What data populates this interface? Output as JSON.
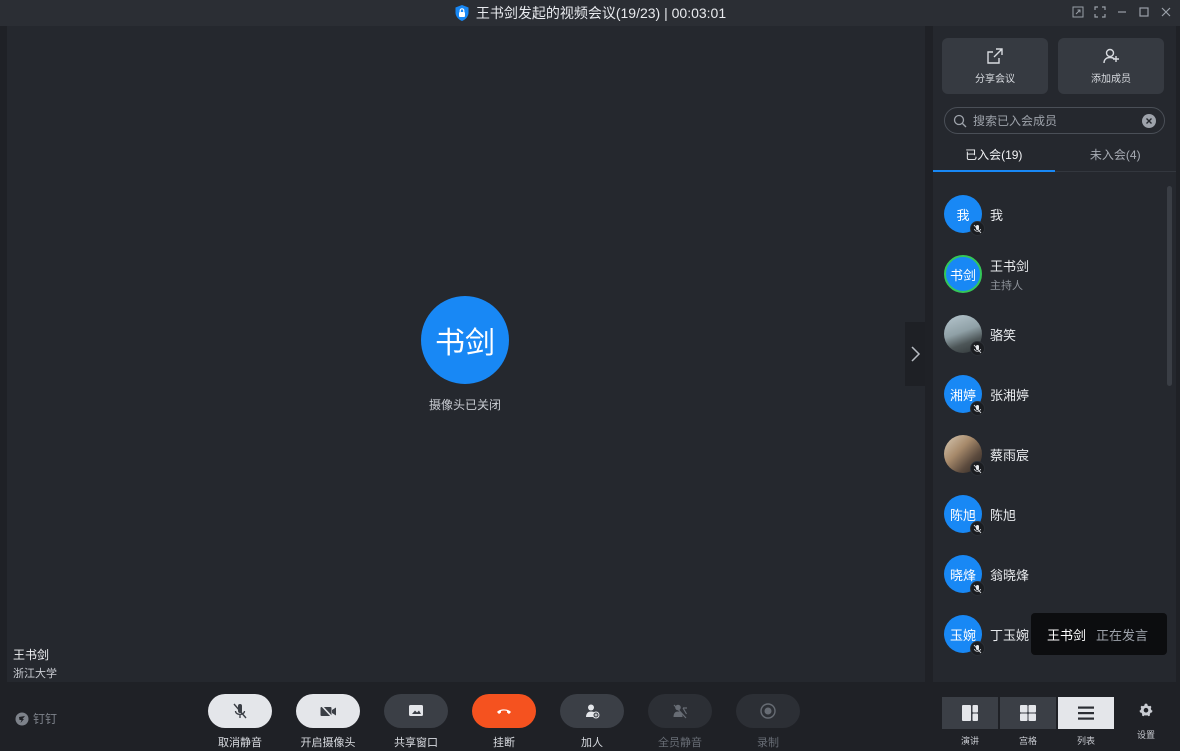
{
  "window": {
    "title": "王书剑发起的视频会议(19/23) | 00:03:01"
  },
  "stage": {
    "avatar_text": "书剑",
    "camera_status": "摄像头已关闭",
    "speaker_name": "王书剑",
    "speaker_org": "浙江大学"
  },
  "panel": {
    "share_label": "分享会议",
    "add_label": "添加成员",
    "search_placeholder": "搜索已入会成员",
    "tab_joined": "已入会(19)",
    "tab_not_joined": "未入会(4)",
    "members": [
      {
        "avatar": "我",
        "name": "我",
        "role": ""
      },
      {
        "avatar": "书剑",
        "name": "王书剑",
        "role": "主持人"
      },
      {
        "avatar": "",
        "name": "骆笑",
        "role": ""
      },
      {
        "avatar": "湘婷",
        "name": "张湘婷",
        "role": ""
      },
      {
        "avatar": "",
        "name": "蔡雨宸",
        "role": ""
      },
      {
        "avatar": "陈旭",
        "name": "陈旭",
        "role": ""
      },
      {
        "avatar": "晓烽",
        "name": "翁晓烽",
        "role": ""
      },
      {
        "avatar": "玉婉",
        "name": "丁玉婉",
        "role": ""
      }
    ]
  },
  "toast": {
    "who": "王书剑",
    "state": "正在发言"
  },
  "bottom": {
    "brand": "钉钉",
    "unmute": "取消静音",
    "camera_on": "开启摄像头",
    "share_window": "共享窗口",
    "hang_up": "挂断",
    "add_person": "加人",
    "mute_all": "全员静音",
    "record": "录制",
    "view_speaker": "演讲",
    "view_grid": "宫格",
    "view_list": "列表",
    "settings": "设置"
  },
  "colors": {
    "accent": "#1888f5",
    "hangup": "#f5521f",
    "host_ring": "#34c759"
  }
}
